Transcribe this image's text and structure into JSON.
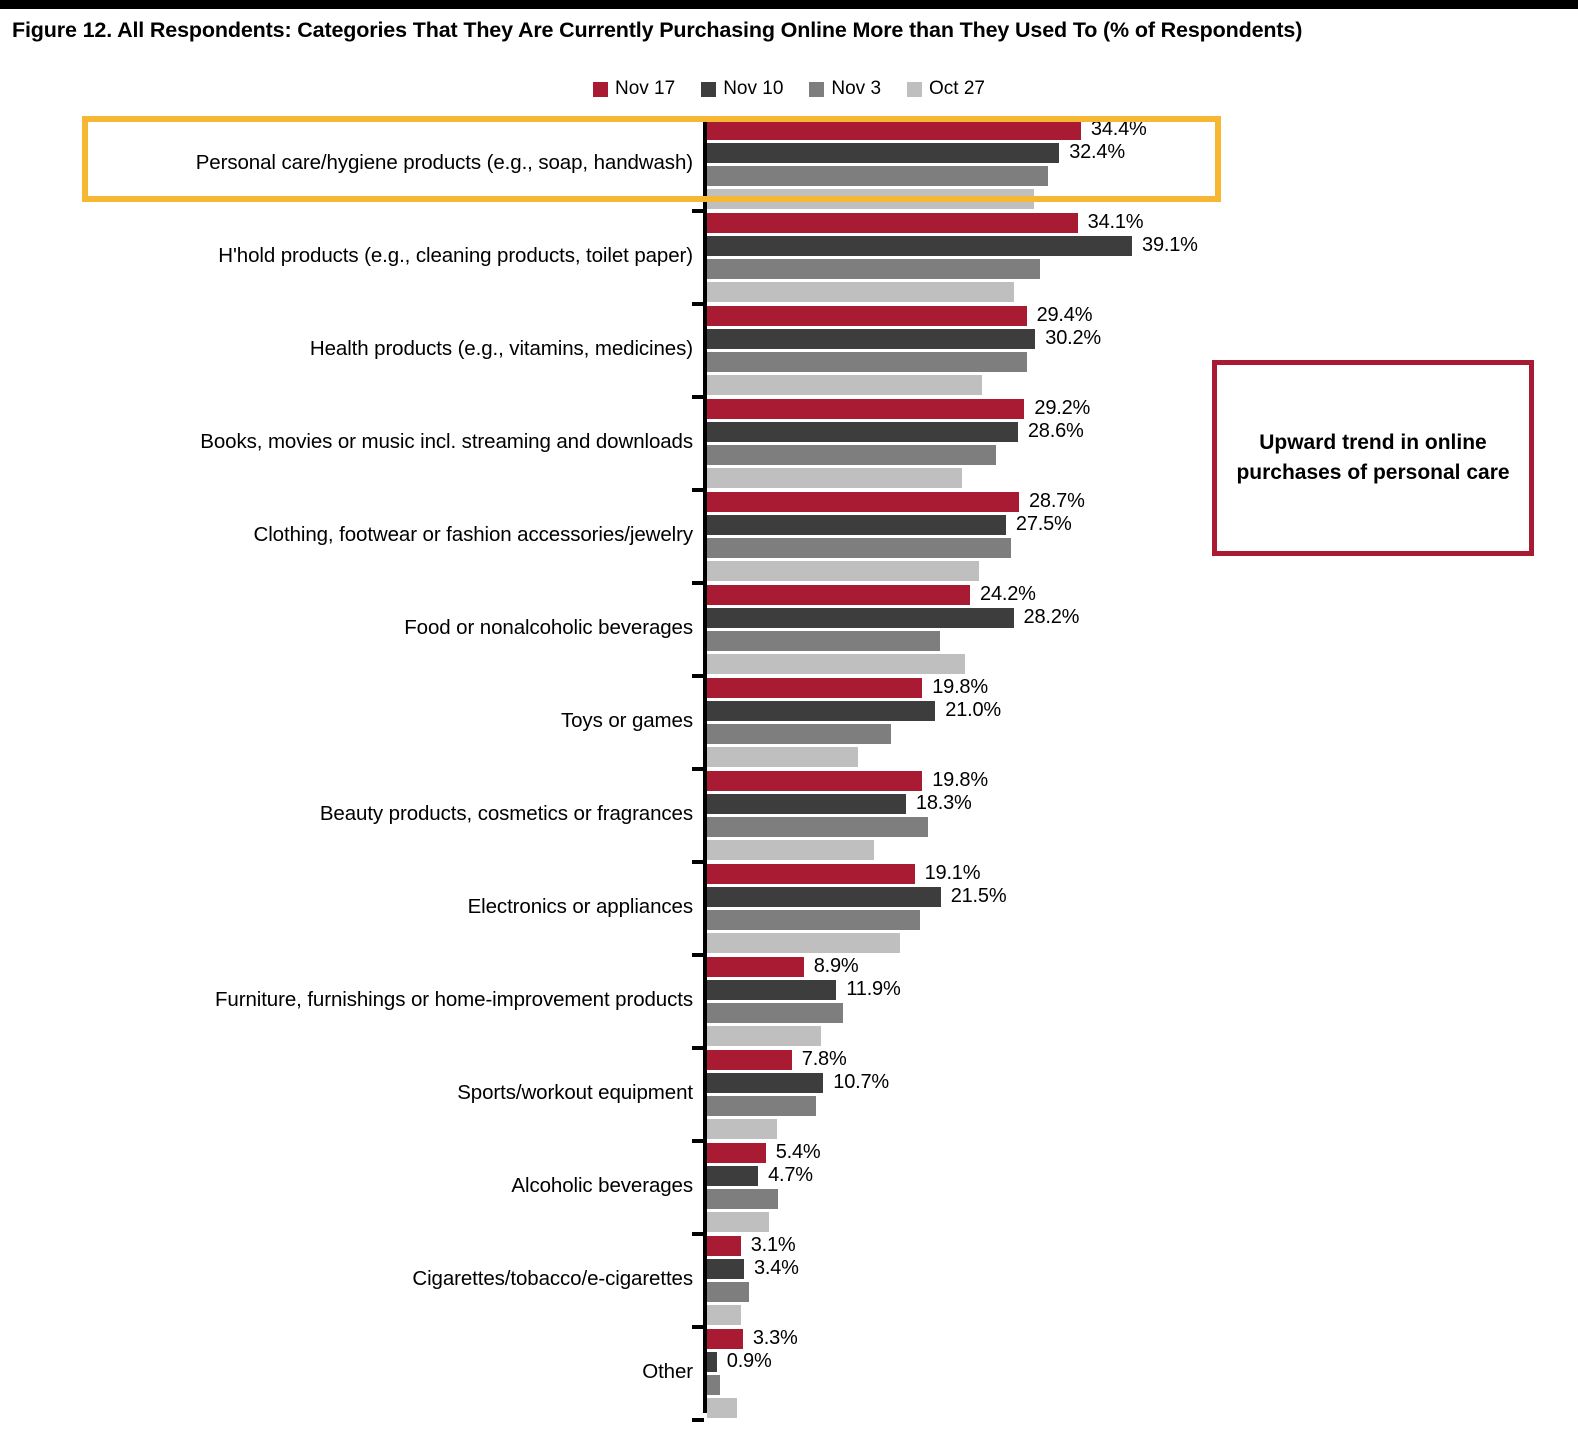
{
  "figure": {
    "title": "Figure 12. All Respondents: Categories That They Are Currently Purchasing Online More than They Used To (% of Respondents)"
  },
  "annotation": {
    "text": "Upward trend in online purchases of personal care",
    "border_color": "#a91b32"
  },
  "highlight": {
    "target_category": "Personal care/hygiene products (e.g., soap, handwash)",
    "border_color": "#f6b832"
  },
  "colors": {
    "nov17": "#a91b32",
    "nov10": "#3d3d3d",
    "nov3": "#7e7e7e",
    "oct27": "#bfbfbf",
    "axis": "#000000",
    "text": "#000000"
  },
  "chart_data": {
    "type": "bar",
    "orientation": "horizontal",
    "title": "Figure 12. All Respondents: Categories That They Are Currently Purchasing Online More than They Used To (% of Respondents)",
    "xlabel": "",
    "ylabel": "",
    "xlim": [
      0,
      40
    ],
    "grid": false,
    "legend_position": "top-center",
    "value_suffix": "%",
    "labeled_series": [
      "Nov 17",
      "Nov 10"
    ],
    "categories": [
      "Personal care/hygiene products (e.g., soap, handwash)",
      "H'hold products (e.g., cleaning products, toilet paper)",
      "Health products (e.g., vitamins, medicines)",
      "Books, movies or music incl. streaming and downloads",
      "Clothing, footwear or fashion accessories/jewelry",
      "Food or nonalcoholic beverages",
      "Toys or games",
      "Beauty products, cosmetics or fragrances",
      "Electronics or appliances",
      "Furniture, furnishings or home-improvement products",
      "Sports/workout equipment",
      "Alcoholic beverages",
      "Cigarettes/tobacco/e-cigarettes",
      "Other"
    ],
    "series": [
      {
        "name": "Nov 17",
        "color": "#a91b32",
        "values": [
          34.4,
          34.1,
          29.4,
          29.2,
          28.7,
          24.2,
          19.8,
          19.8,
          19.1,
          8.9,
          7.8,
          5.4,
          3.1,
          3.3
        ],
        "labels": [
          "34.4%",
          "34.1%",
          "29.4%",
          "29.2%",
          "28.7%",
          "24.2%",
          "19.8%",
          "19.8%",
          "19.1%",
          "8.9%",
          "7.8%",
          "5.4%",
          "3.1%",
          "3.3%"
        ]
      },
      {
        "name": "Nov 10",
        "color": "#3d3d3d",
        "values": [
          32.4,
          39.1,
          30.2,
          28.6,
          27.5,
          28.2,
          21.0,
          18.3,
          21.5,
          11.9,
          10.7,
          4.7,
          3.4,
          0.9
        ],
        "labels": [
          "32.4%",
          "39.1%",
          "30.2%",
          "28.6%",
          "27.5%",
          "28.2%",
          "21.0%",
          "18.3%",
          "21.5%",
          "11.9%",
          "10.7%",
          "4.7%",
          "3.4%",
          "0.9%"
        ]
      },
      {
        "name": "Nov 3",
        "color": "#7e7e7e",
        "values": [
          31.4,
          30.6,
          29.4,
          26.6,
          28.0,
          21.4,
          16.9,
          20.3,
          19.6,
          12.5,
          10.0,
          6.5,
          3.9,
          1.2
        ],
        "labels": [
          "",
          "",
          "",
          "",
          "",
          "",
          "",
          "",
          "",
          "",
          "",
          "",
          "",
          ""
        ]
      },
      {
        "name": "Oct 27",
        "color": "#bfbfbf",
        "values": [
          30.1,
          28.2,
          25.3,
          23.5,
          25.0,
          23.7,
          13.9,
          15.4,
          17.8,
          10.5,
          6.4,
          5.7,
          3.1,
          2.8
        ],
        "labels": [
          "",
          "",
          "",
          "",
          "",
          "",
          "",
          "",
          "",
          "",
          "",
          "",
          "",
          ""
        ]
      }
    ]
  }
}
